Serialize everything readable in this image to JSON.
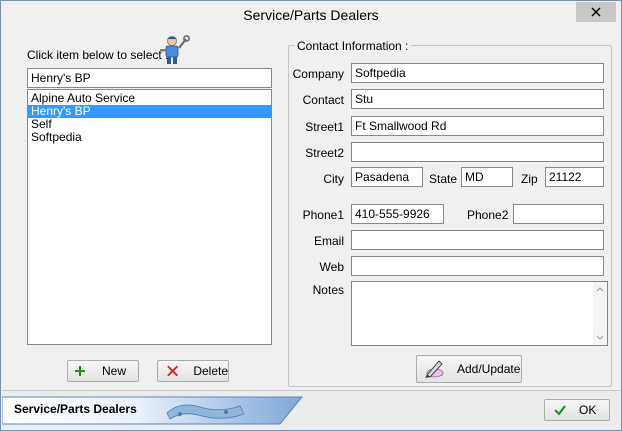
{
  "window": {
    "title": "Service/Parts Dealers"
  },
  "left": {
    "instruction": "Click item below to select :",
    "selected_value": "Henry's BP",
    "items": [
      {
        "label": "Alpine Auto Service"
      },
      {
        "label": "Henry's BP"
      },
      {
        "label": "Self"
      },
      {
        "label": "Softpedia"
      }
    ],
    "new_label": "New",
    "delete_label": "Delete"
  },
  "contact": {
    "group_label": "Contact Information :",
    "company_label": "Company",
    "company_value": "Softpedia",
    "contact_label": "Contact",
    "contact_value": "Stu",
    "street1_label": "Street1",
    "street1_value": "Ft Smallwood Rd",
    "street2_label": "Street2",
    "street2_value": "",
    "city_label": "City",
    "city_value": "Pasadena",
    "state_label": "State",
    "state_value": "MD",
    "zip_label": "Zip",
    "zip_value": "21122",
    "phone1_label": "Phone1",
    "phone1_value": "410-555-9926",
    "phone2_label": "Phone2",
    "phone2_value": "",
    "email_label": "Email",
    "email_value": "",
    "web_label": "Web",
    "web_value": "",
    "notes_label": "Notes",
    "notes_value": "",
    "add_update_label": "Add/Update"
  },
  "footer": {
    "banner_label": "Service/Parts Dealers",
    "ok_label": "OK"
  },
  "colors": {
    "selection": "#3399ff",
    "accent": "#7a8fb0"
  }
}
